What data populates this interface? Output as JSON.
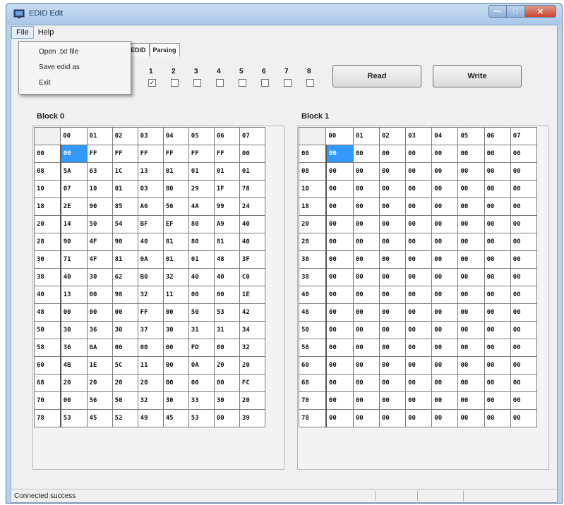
{
  "window": {
    "title": "EDID Edit"
  },
  "menu": {
    "file": "File",
    "help": "Help"
  },
  "file_menu": {
    "items": [
      "Open .txt file",
      "Save edid as",
      "Exit"
    ]
  },
  "tabs": [
    "EDID",
    "Parsing"
  ],
  "checkboxes": [
    {
      "label": "1",
      "checked": true
    },
    {
      "label": "2",
      "checked": false
    },
    {
      "label": "3",
      "checked": false
    },
    {
      "label": "4",
      "checked": false
    },
    {
      "label": "5",
      "checked": false
    },
    {
      "label": "6",
      "checked": false
    },
    {
      "label": "7",
      "checked": false
    },
    {
      "label": "8",
      "checked": false
    }
  ],
  "buttons": {
    "read": "Read",
    "write": "Write"
  },
  "status": "Connected success",
  "blocks": [
    {
      "label": "Block 0",
      "columns": [
        "00",
        "01",
        "02",
        "03",
        "04",
        "05",
        "06",
        "07"
      ],
      "rows": [
        {
          "addr": "00",
          "cells": [
            "00",
            "FF",
            "FF",
            "FF",
            "FF",
            "FF",
            "FF",
            "00"
          ]
        },
        {
          "addr": "08",
          "cells": [
            "5A",
            "63",
            "1C",
            "13",
            "01",
            "01",
            "01",
            "01"
          ]
        },
        {
          "addr": "10",
          "cells": [
            "07",
            "10",
            "01",
            "03",
            "80",
            "29",
            "1F",
            "78"
          ]
        },
        {
          "addr": "18",
          "cells": [
            "2E",
            "90",
            "85",
            "A6",
            "56",
            "4A",
            "99",
            "24"
          ]
        },
        {
          "addr": "20",
          "cells": [
            "14",
            "50",
            "54",
            "BF",
            "EF",
            "80",
            "A9",
            "40"
          ]
        },
        {
          "addr": "28",
          "cells": [
            "90",
            "4F",
            "90",
            "40",
            "81",
            "80",
            "81",
            "40"
          ]
        },
        {
          "addr": "30",
          "cells": [
            "71",
            "4F",
            "81",
            "0A",
            "01",
            "01",
            "48",
            "3F"
          ]
        },
        {
          "addr": "38",
          "cells": [
            "40",
            "30",
            "62",
            "B0",
            "32",
            "40",
            "40",
            "C0"
          ]
        },
        {
          "addr": "40",
          "cells": [
            "13",
            "00",
            "98",
            "32",
            "11",
            "00",
            "00",
            "1E"
          ]
        },
        {
          "addr": "48",
          "cells": [
            "00",
            "00",
            "00",
            "FF",
            "00",
            "50",
            "53",
            "42"
          ]
        },
        {
          "addr": "50",
          "cells": [
            "30",
            "36",
            "30",
            "37",
            "30",
            "31",
            "31",
            "34"
          ]
        },
        {
          "addr": "58",
          "cells": [
            "36",
            "0A",
            "00",
            "00",
            "00",
            "FD",
            "00",
            "32"
          ]
        },
        {
          "addr": "60",
          "cells": [
            "4B",
            "1E",
            "5C",
            "11",
            "00",
            "0A",
            "20",
            "20"
          ]
        },
        {
          "addr": "68",
          "cells": [
            "20",
            "20",
            "20",
            "20",
            "00",
            "00",
            "00",
            "FC"
          ]
        },
        {
          "addr": "70",
          "cells": [
            "00",
            "56",
            "50",
            "32",
            "30",
            "33",
            "30",
            "20"
          ]
        },
        {
          "addr": "78",
          "cells": [
            "53",
            "45",
            "52",
            "49",
            "45",
            "53",
            "00",
            "39"
          ]
        }
      ]
    },
    {
      "label": "Block 1",
      "columns": [
        "00",
        "01",
        "02",
        "03",
        "04",
        "05",
        "06",
        "07"
      ],
      "rows": [
        {
          "addr": "00",
          "cells": [
            "00",
            "00",
            "00",
            "00",
            "00",
            "00",
            "00",
            "00"
          ]
        },
        {
          "addr": "08",
          "cells": [
            "00",
            "00",
            "00",
            "00",
            "00",
            "00",
            "00",
            "00"
          ]
        },
        {
          "addr": "10",
          "cells": [
            "00",
            "00",
            "00",
            "00",
            "00",
            "00",
            "00",
            "00"
          ]
        },
        {
          "addr": "18",
          "cells": [
            "00",
            "00",
            "00",
            "00",
            "00",
            "00",
            "00",
            "00"
          ]
        },
        {
          "addr": "20",
          "cells": [
            "00",
            "00",
            "00",
            "00",
            "00",
            "00",
            "00",
            "00"
          ]
        },
        {
          "addr": "28",
          "cells": [
            "00",
            "00",
            "00",
            "00",
            "00",
            "00",
            "00",
            "00"
          ]
        },
        {
          "addr": "30",
          "cells": [
            "00",
            "00",
            "00",
            "00",
            "00",
            "00",
            "00",
            "00"
          ]
        },
        {
          "addr": "38",
          "cells": [
            "00",
            "00",
            "00",
            "00",
            "00",
            "00",
            "00",
            "00"
          ]
        },
        {
          "addr": "40",
          "cells": [
            "00",
            "00",
            "00",
            "00",
            "00",
            "00",
            "00",
            "00"
          ]
        },
        {
          "addr": "48",
          "cells": [
            "00",
            "00",
            "00",
            "00",
            "00",
            "00",
            "00",
            "00"
          ]
        },
        {
          "addr": "50",
          "cells": [
            "00",
            "00",
            "00",
            "00",
            "00",
            "00",
            "00",
            "00"
          ]
        },
        {
          "addr": "58",
          "cells": [
            "00",
            "00",
            "00",
            "00",
            "00",
            "00",
            "00",
            "00"
          ]
        },
        {
          "addr": "60",
          "cells": [
            "00",
            "00",
            "00",
            "00",
            "00",
            "00",
            "00",
            "00"
          ]
        },
        {
          "addr": "68",
          "cells": [
            "00",
            "00",
            "00",
            "00",
            "00",
            "00",
            "00",
            "00"
          ]
        },
        {
          "addr": "70",
          "cells": [
            "00",
            "00",
            "00",
            "00",
            "00",
            "00",
            "00",
            "00"
          ]
        },
        {
          "addr": "78",
          "cells": [
            "00",
            "00",
            "00",
            "00",
            "00",
            "00",
            "00",
            "00"
          ]
        }
      ]
    }
  ],
  "colors": {
    "selection": "#3399ff",
    "title_bar": "#a9c7e8",
    "close_button": "#c7442c"
  }
}
